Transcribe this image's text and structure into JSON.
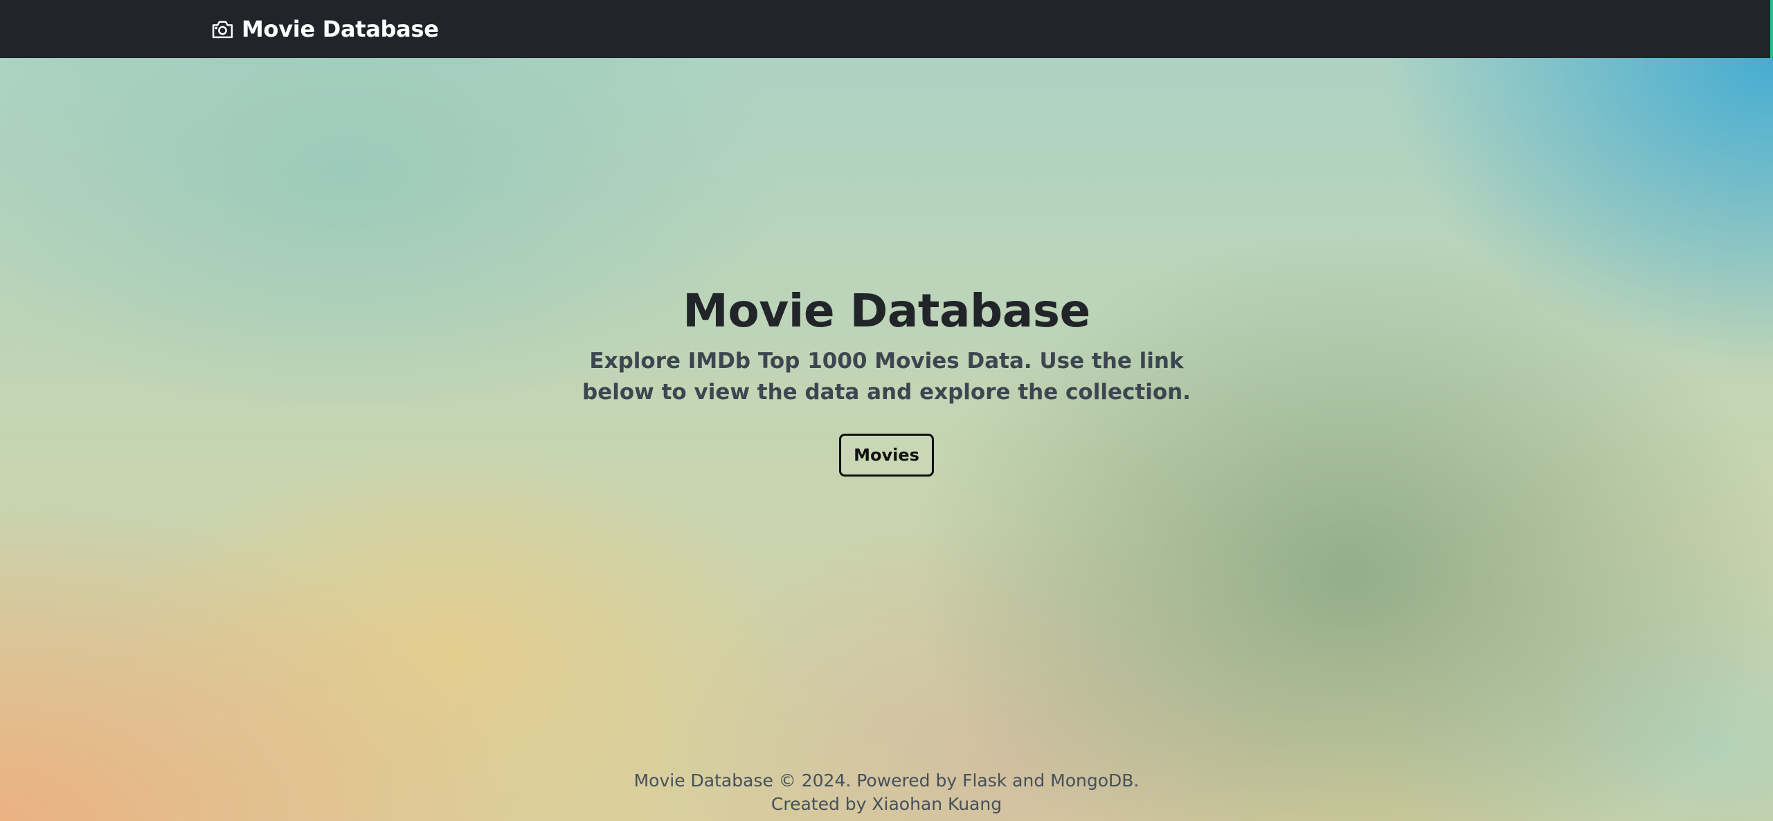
{
  "navbar": {
    "brand_icon": "camera-icon",
    "brand_label": "Movie Database"
  },
  "hero": {
    "title": "Movie Database",
    "lead": "Explore IMDb Top 1000 Movies Data. Use the link below to view the data and explore the collection.",
    "button_label": "Movies"
  },
  "footer": {
    "line1": "Movie Database © 2024. Powered by Flask and MongoDB.",
    "line2": "Created by Xiaohan Kuang"
  },
  "colors": {
    "navbar_bg": "#212529",
    "text_dark": "#212529"
  }
}
